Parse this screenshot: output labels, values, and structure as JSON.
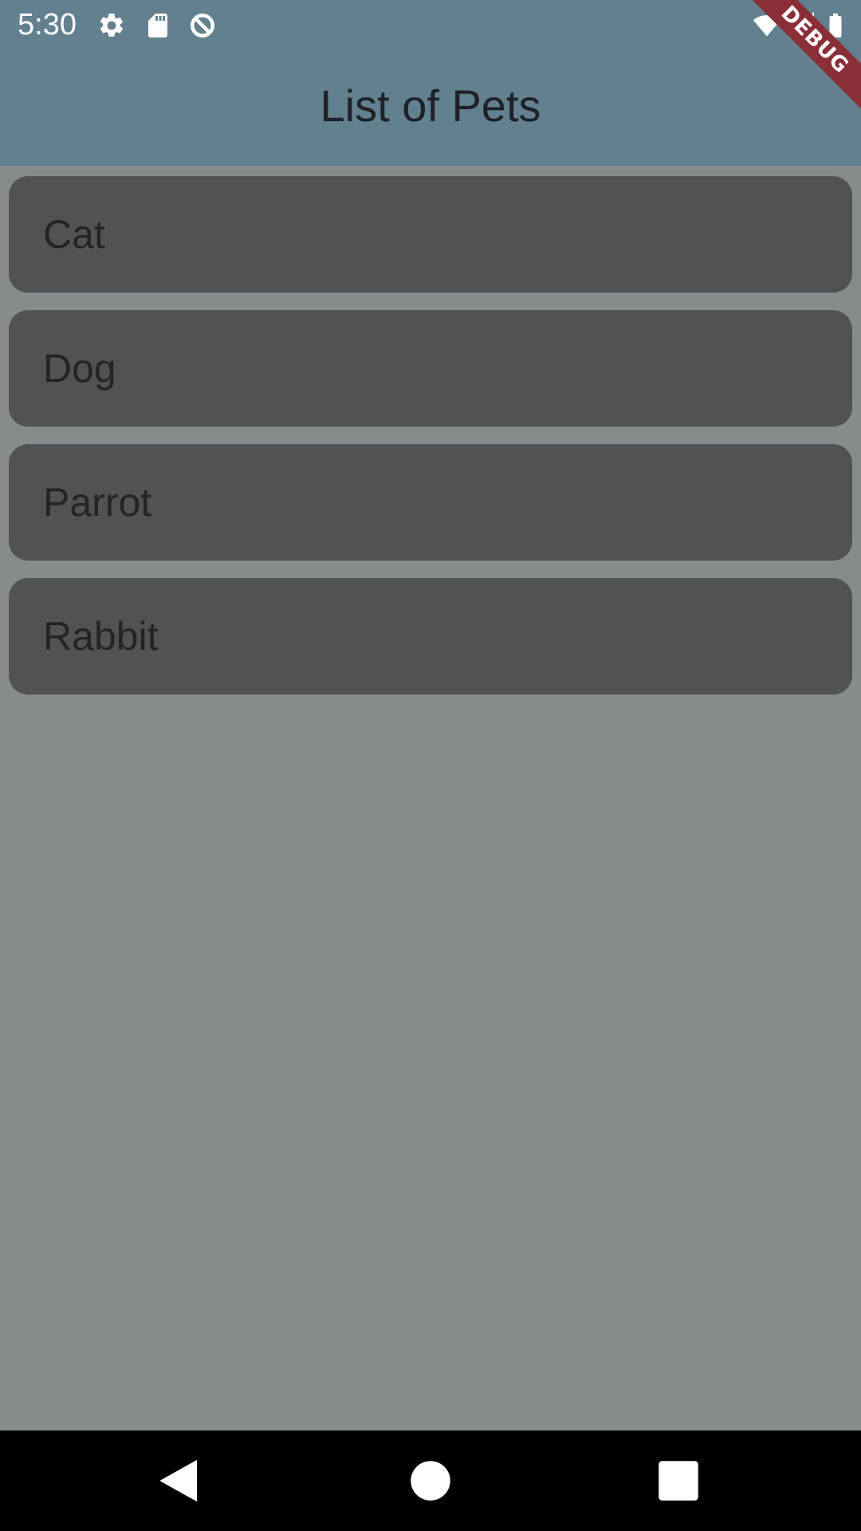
{
  "status_bar": {
    "time": "5:30",
    "left_icons": [
      "gear-icon",
      "sd-card-icon",
      "data-saver-icon"
    ],
    "right_icons": [
      "wifi-icon",
      "cell-signal-icon",
      "battery-icon"
    ]
  },
  "debug_banner": {
    "label": "DEBUG",
    "color": "#8a2f37"
  },
  "app_bar": {
    "title": "List of Pets",
    "color": "#62808d"
  },
  "pets": [
    {
      "label": "Cat"
    },
    {
      "label": "Dog"
    },
    {
      "label": "Parrot"
    },
    {
      "label": "Rabbit"
    }
  ],
  "colors": {
    "background": "#868b8e",
    "card": "#525252",
    "text": "#232428"
  },
  "nav_bar": {
    "icons": [
      "back-icon",
      "home-icon",
      "recents-icon"
    ]
  }
}
